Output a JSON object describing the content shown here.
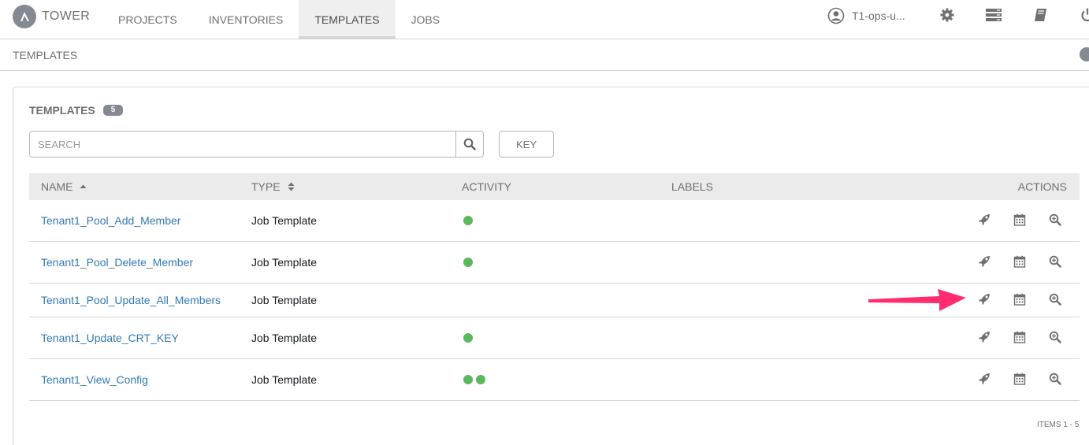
{
  "nav": {
    "brand": "TOWER",
    "links": [
      "PROJECTS",
      "INVENTORIES",
      "TEMPLATES",
      "JOBS"
    ],
    "active": "TEMPLATES",
    "user": "T1-ops-u...",
    "icons": [
      "user-icon",
      "gear-icon",
      "server-icon",
      "book-icon",
      "power-icon"
    ]
  },
  "breadcrumb": "TEMPLATES",
  "panel": {
    "title": "TEMPLATES",
    "count": "5",
    "search_placeholder": "SEARCH",
    "key_label": "KEY"
  },
  "table": {
    "headers": {
      "name": "NAME",
      "type": "TYPE",
      "activity": "ACTIVITY",
      "labels": "LABELS",
      "actions": "ACTIONS"
    },
    "rows": [
      {
        "name": "Tenant1_Pool_Add_Member",
        "type": "Job Template",
        "activity": [
          "successful"
        ]
      },
      {
        "name": "Tenant1_Pool_Delete_Member",
        "type": "Job Template",
        "activity": [
          "successful"
        ]
      },
      {
        "name": "Tenant1_Pool_Update_All_Members",
        "type": "Job Template",
        "activity": []
      },
      {
        "name": "Tenant1_Update_CRT_KEY",
        "type": "Job Template",
        "activity": [
          "successful"
        ]
      },
      {
        "name": "Tenant1_View_Config",
        "type": "Job Template",
        "activity": [
          "successful",
          "successful"
        ]
      }
    ],
    "row_actions": [
      "rocket-icon",
      "calendar-icon",
      "zoom-in-icon"
    ]
  },
  "pagination": {
    "items": "ITEMS  1 - 5"
  },
  "colors": {
    "link": "#337ab7",
    "success": "#5cb85c",
    "annotation_arrow": "#ff2d6f",
    "header_bg": "#ebebeb"
  }
}
